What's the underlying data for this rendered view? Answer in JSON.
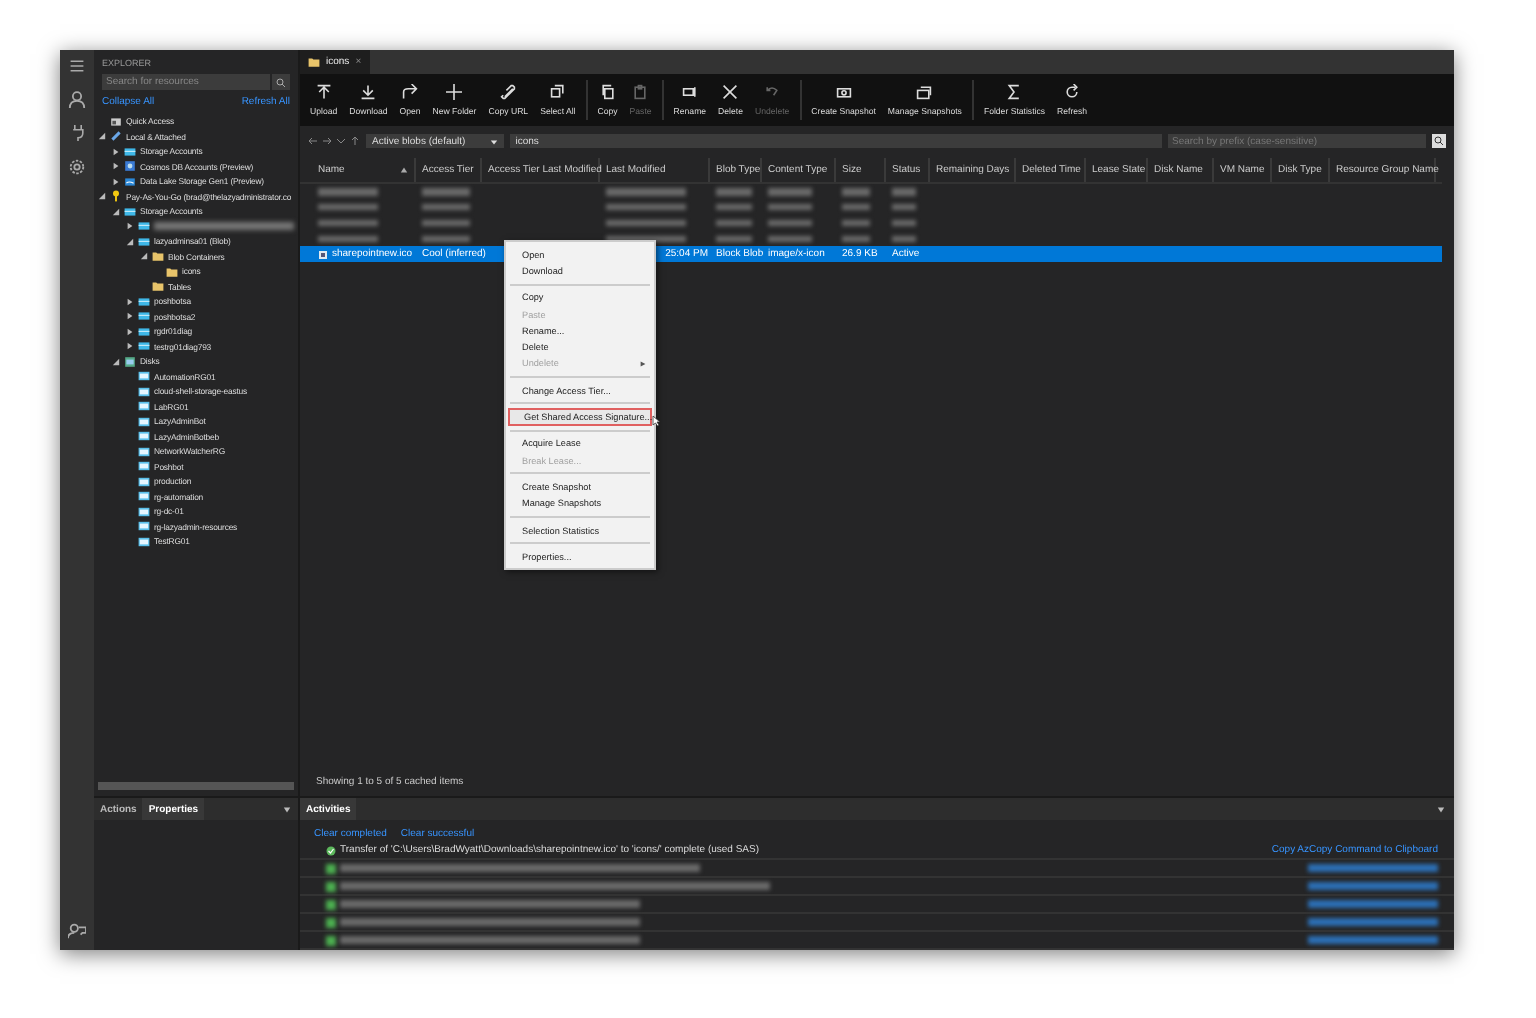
{
  "sidebar": {
    "title": "EXPLORER",
    "search": {
      "placeholder": "Search for resources"
    },
    "collapse_all": "Collapse All",
    "refresh_all": "Refresh All",
    "tree": [
      {
        "label": "Quick Access",
        "kind": "quick"
      },
      {
        "label": "Local & Attached",
        "kind": "link",
        "expanded": true,
        "children": [
          {
            "label": "Storage Accounts",
            "kind": "storage",
            "expanded": false
          },
          {
            "label": "Cosmos DB Accounts (Preview)",
            "kind": "cosmos",
            "expanded": false
          },
          {
            "label": "Data Lake Storage Gen1 (Preview)",
            "kind": "lake",
            "expanded": false
          }
        ]
      },
      {
        "label": "Pay-As-You-Go (brad@thelazyadministrator.co",
        "kind": "key",
        "expanded": true,
        "children": [
          {
            "label": "Storage Accounts",
            "kind": "storage",
            "expanded": true,
            "children": [
              {
                "kind": "blurred",
                "expanded": false
              },
              {
                "label": "lazyadminsa01 (Blob)",
                "kind": "storage",
                "expanded": true,
                "children": [
                  {
                    "label": "Blob Containers",
                    "kind": "folder",
                    "expanded": true,
                    "children": [
                      {
                        "label": "icons",
                        "kind": "folder"
                      }
                    ]
                  },
                  {
                    "label": "Tables",
                    "kind": "folder"
                  }
                ]
              },
              {
                "label": "poshbotsa",
                "kind": "storage",
                "expanded": false
              },
              {
                "label": "poshbotsa2",
                "kind": "storage",
                "expanded": false
              },
              {
                "label": "rgdr01diag",
                "kind": "storage",
                "expanded": false
              },
              {
                "label": "testrg01diag793",
                "kind": "storage",
                "expanded": false
              }
            ]
          },
          {
            "label": "Disks",
            "kind": "disks",
            "expanded": true,
            "children": [
              {
                "label": "AutomationRG01",
                "kind": "group"
              },
              {
                "label": "cloud-shell-storage-eastus",
                "kind": "group"
              },
              {
                "label": "LabRG01",
                "kind": "group"
              },
              {
                "label": "LazyAdminBot",
                "kind": "group"
              },
              {
                "label": "LazyAdminBotbeb",
                "kind": "group"
              },
              {
                "label": "NetworkWatcherRG",
                "kind": "group"
              },
              {
                "label": "Poshbot",
                "kind": "group"
              },
              {
                "label": "production",
                "kind": "group"
              },
              {
                "label": "rg-automation",
                "kind": "group"
              },
              {
                "label": "rg-dc-01",
                "kind": "group"
              },
              {
                "label": "rg-lazyadmin-resources",
                "kind": "group"
              },
              {
                "label": "TestRG01",
                "kind": "group"
              }
            ]
          }
        ]
      }
    ]
  },
  "editor_tab": {
    "label": "icons",
    "close": "×"
  },
  "toolbar": [
    {
      "label": "Upload",
      "kind": "upload",
      "disabled": false
    },
    {
      "label": "Download",
      "kind": "download",
      "disabled": false
    },
    {
      "label": "Open",
      "kind": "open",
      "disabled": false
    },
    {
      "label": "New Folder",
      "kind": "plus",
      "disabled": false
    },
    {
      "label": "Copy URL",
      "kind": "link",
      "disabled": false
    },
    {
      "label": "Select All",
      "kind": "select",
      "disabled": false
    },
    {
      "label": "Copy",
      "kind": "copy",
      "disabled": false
    },
    {
      "label": "Paste",
      "kind": "paste",
      "disabled": true
    },
    {
      "label": "Rename",
      "kind": "rename",
      "disabled": false
    },
    {
      "label": "Delete",
      "kind": "delete",
      "disabled": false
    },
    {
      "label": "Undelete",
      "kind": "undo",
      "disabled": true
    },
    {
      "label": "Create Snapshot",
      "kind": "snapshot",
      "disabled": false
    },
    {
      "label": "Manage Snapshots",
      "kind": "snapshots",
      "disabled": false
    },
    {
      "label": "Folder Statistics",
      "kind": "sigma",
      "disabled": false
    },
    {
      "label": "Refresh",
      "kind": "refresh",
      "disabled": false
    }
  ],
  "address": {
    "view_filter": "Active blobs (default)",
    "path": "icons",
    "search": {
      "placeholder": "Search by prefix (case-sensitive)"
    }
  },
  "table": {
    "columns": [
      "Name",
      "Access Tier",
      "Access Tier Last Modified",
      "Last Modified",
      "Blob Type",
      "Content Type",
      "Size",
      "Status",
      "Remaining Days",
      "Deleted Time",
      "Lease State",
      "Disk Name",
      "VM Name",
      "Disk Type",
      "Resource Group Name"
    ],
    "rows": [
      {
        "kind": "blurred",
        "selected": false
      },
      {
        "kind": "blurred",
        "selected": false
      },
      {
        "kind": "blurred",
        "selected": false
      },
      {
        "kind": "blurred",
        "selected": false
      },
      {
        "kind": "blob",
        "selected": true,
        "cells": {
          "name": "sharepointnew.ico",
          "access_tier": "Cool (inferred)",
          "last_modified": "25:04 PM",
          "blob_type": "Block Blob",
          "content_type": "image/x-icon",
          "size": "26.9 KB",
          "status": "Active"
        }
      }
    ]
  },
  "status": "Showing 1 to 5 of 5 cached items",
  "context_menu": [
    {
      "kind": "item",
      "label": "Open",
      "disabled": false
    },
    {
      "kind": "item",
      "label": "Download",
      "disabled": false
    },
    {
      "kind": "separator"
    },
    {
      "kind": "item",
      "label": "Copy",
      "disabled": false
    },
    {
      "kind": "item",
      "label": "Paste",
      "disabled": true
    },
    {
      "kind": "item",
      "label": "Rename...",
      "disabled": false
    },
    {
      "kind": "item",
      "label": "Delete",
      "disabled": false
    },
    {
      "kind": "item",
      "label": "Undelete",
      "disabled": true,
      "submenu": true
    },
    {
      "kind": "separator"
    },
    {
      "kind": "item",
      "label": "Change Access Tier...",
      "disabled": false
    },
    {
      "kind": "separator"
    },
    {
      "kind": "item",
      "label": "Get Shared Access Signature...",
      "disabled": false,
      "highlighted": true
    },
    {
      "kind": "separator"
    },
    {
      "kind": "item",
      "label": "Acquire Lease",
      "disabled": false
    },
    {
      "kind": "item",
      "label": "Break Lease...",
      "disabled": true
    },
    {
      "kind": "separator"
    },
    {
      "kind": "item",
      "label": "Create Snapshot",
      "disabled": false
    },
    {
      "kind": "item",
      "label": "Manage Snapshots",
      "disabled": false
    },
    {
      "kind": "separator"
    },
    {
      "kind": "item",
      "label": "Selection Statistics",
      "disabled": false
    },
    {
      "kind": "separator"
    },
    {
      "kind": "item",
      "label": "Properties...",
      "disabled": false
    }
  ],
  "left_panel": {
    "tabs": [
      {
        "label": "Actions",
        "selected": false
      },
      {
        "label": "Properties",
        "selected": true
      }
    ]
  },
  "activities": {
    "tab": "Activities",
    "actions": [
      "Clear completed",
      "Clear successful"
    ],
    "items": [
      {
        "kind": "transfer",
        "text": "Transfer of 'C:\\Users\\BradWyatt\\Downloads\\sharepointnew.ico' to 'icons/' complete (used SAS)",
        "link": "Copy AzCopy Command to Clipboard"
      },
      {
        "kind": "blurred"
      },
      {
        "kind": "blurred"
      },
      {
        "kind": "blurred"
      },
      {
        "kind": "blurred"
      },
      {
        "kind": "blurred"
      }
    ]
  }
}
